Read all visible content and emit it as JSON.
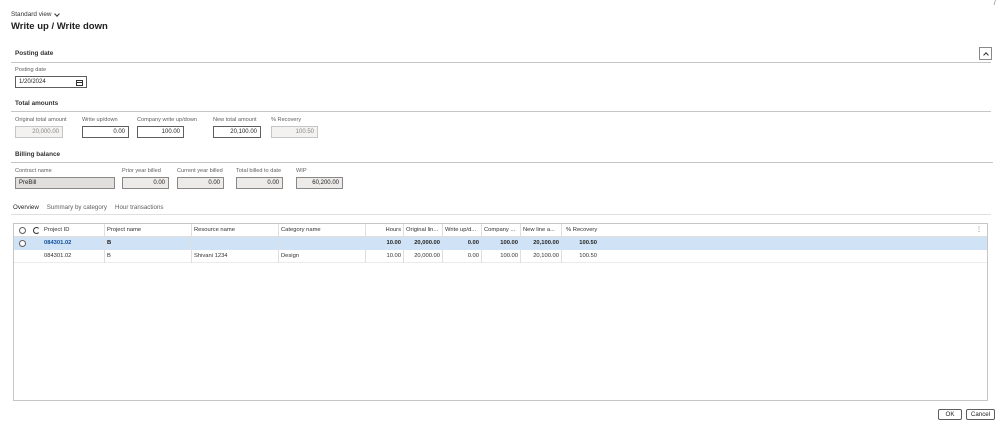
{
  "header": {
    "view_label": "Standard view",
    "title": "Write up / Write down"
  },
  "posting_date": {
    "section_title": "Posting date",
    "label": "Posting date",
    "value": "1/20/2024"
  },
  "total_amounts": {
    "section_title": "Total amounts",
    "original_total_label": "Original total amount",
    "original_total_value": "20,000.00",
    "write_updown_label": "Write up/down",
    "write_updown_value": "0.00",
    "company_write_label": "Company write up/down",
    "company_write_value": "100.00",
    "new_total_label": "New total amount",
    "new_total_value": "20,100.00",
    "recovery_label": "% Recovery",
    "recovery_value": "100.50"
  },
  "billing_balance": {
    "section_title": "Billing balance",
    "contract_label": "Contract name",
    "contract_value": "PreBill",
    "prior_year_label": "Prior year billed",
    "prior_year_value": "0.00",
    "current_year_label": "Current year billed",
    "current_year_value": "0.00",
    "total_billed_label": "Total billed to date",
    "total_billed_value": "0.00",
    "wip_label": "WIP",
    "wip_value": "60,200.00"
  },
  "tabs": [
    "Overview",
    "Summary by category",
    "Hour transactions"
  ],
  "grid": {
    "columns": [
      "Project ID",
      "Project name",
      "Resource name",
      "Category name",
      "Hours",
      "Original lin...",
      "Write up/d...",
      "Company ...",
      "New line a...",
      "% Recovery"
    ],
    "rows": [
      [
        "084301.02",
        "B",
        "",
        "",
        "10.00",
        "20,000.00",
        "0.00",
        "100.00",
        "20,100.00",
        "100.50"
      ],
      [
        "084301.02",
        "B",
        "Shivani 1234",
        "Design",
        "10.00",
        "20,000.00",
        "0.00",
        "100.00",
        "20,100.00",
        "100.50"
      ]
    ]
  },
  "footer": {
    "ok_label": "OK",
    "cancel_label": "Cancel"
  }
}
